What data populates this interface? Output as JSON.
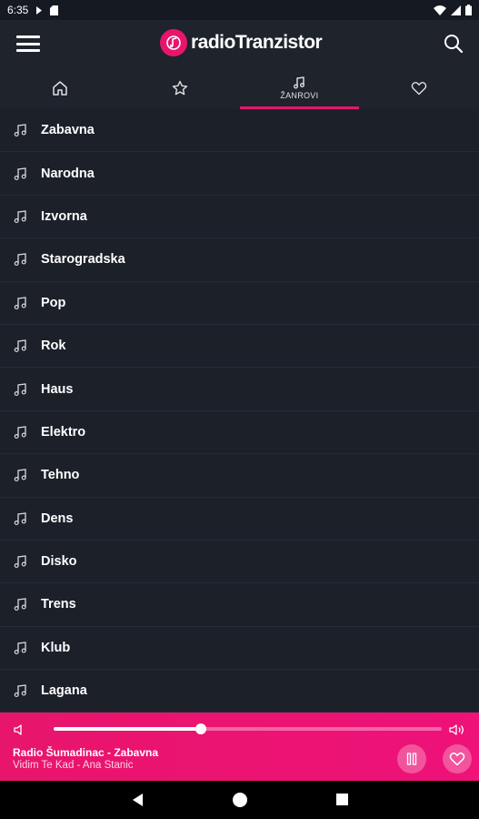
{
  "status_bar": {
    "time": "6:35"
  },
  "app": {
    "title": "radioTranzistor",
    "brand_color": "#e8156c"
  },
  "tabs": [
    {
      "icon": "home-icon",
      "label": ""
    },
    {
      "icon": "star-icon",
      "label": ""
    },
    {
      "icon": "music-note-icon",
      "label": "ŽANROVI",
      "active": true
    },
    {
      "icon": "heart-icon",
      "label": ""
    }
  ],
  "genres": [
    "Zabavna",
    "Narodna",
    "Izvorna",
    "Starogradska",
    "Pop",
    "Rok",
    "Haus",
    "Elektro",
    "Tehno",
    "Dens",
    "Disko",
    "Trens",
    "Klub",
    "Lagana"
  ],
  "player": {
    "station": "Radio Šumadinac - Zabavna",
    "track": "Vidim Te Kad - Ana Stanic",
    "volume_fraction": 0.38
  }
}
